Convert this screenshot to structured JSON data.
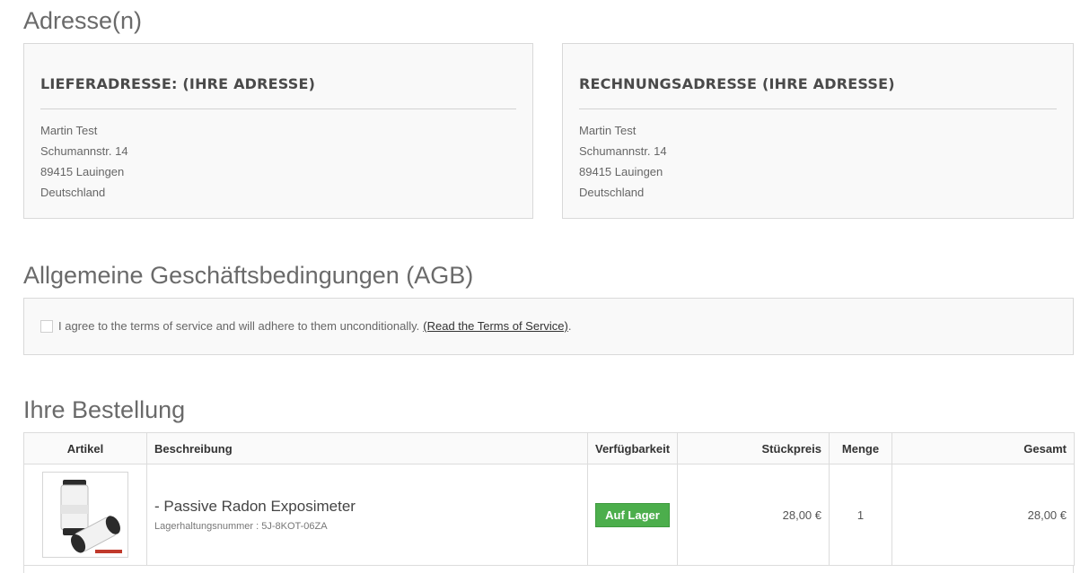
{
  "addresses": {
    "title": "Adresse(n)",
    "delivery": {
      "heading": "LIEFERADRESSE: (IHRE ADRESSE)",
      "lines": [
        "Martin Test",
        "Schumannstr. 14",
        "89415 Lauingen",
        "Deutschland"
      ]
    },
    "billing": {
      "heading": "RECHNUNGSADRESSE (IHRE ADRESSE)",
      "lines": [
        "Martin Test",
        "Schumannstr. 14",
        "89415 Lauingen",
        "Deutschland"
      ]
    }
  },
  "terms": {
    "title": "Allgemeine Geschäftsbedingungen (AGB)",
    "agree_text": "I agree to the terms of service and will adhere to them unconditionally.",
    "link_text": "(Read the Terms of Service)",
    "link_suffix": ".",
    "checked": false
  },
  "order": {
    "title": "Ihre Bestellung",
    "columns": {
      "article": "Artikel",
      "description": "Beschreibung",
      "availability": "Verfügbarkeit",
      "unit_price": "Stückpreis",
      "quantity": "Menge",
      "total": "Gesamt"
    },
    "items": [
      {
        "name": "- Passive Radon Exposimeter",
        "sku_label": "Lagerhaltungsnummer : 5J-8KOT-06ZA",
        "availability": "Auf Lager",
        "unit_price": "28,00 €",
        "quantity": "1",
        "total": "28,00 €"
      }
    ]
  },
  "colors": {
    "badge_green": "#4cae4c",
    "box_background": "#f9f9f9",
    "border": "#d9d9d9",
    "heading_gray": "#6a6a6a"
  }
}
